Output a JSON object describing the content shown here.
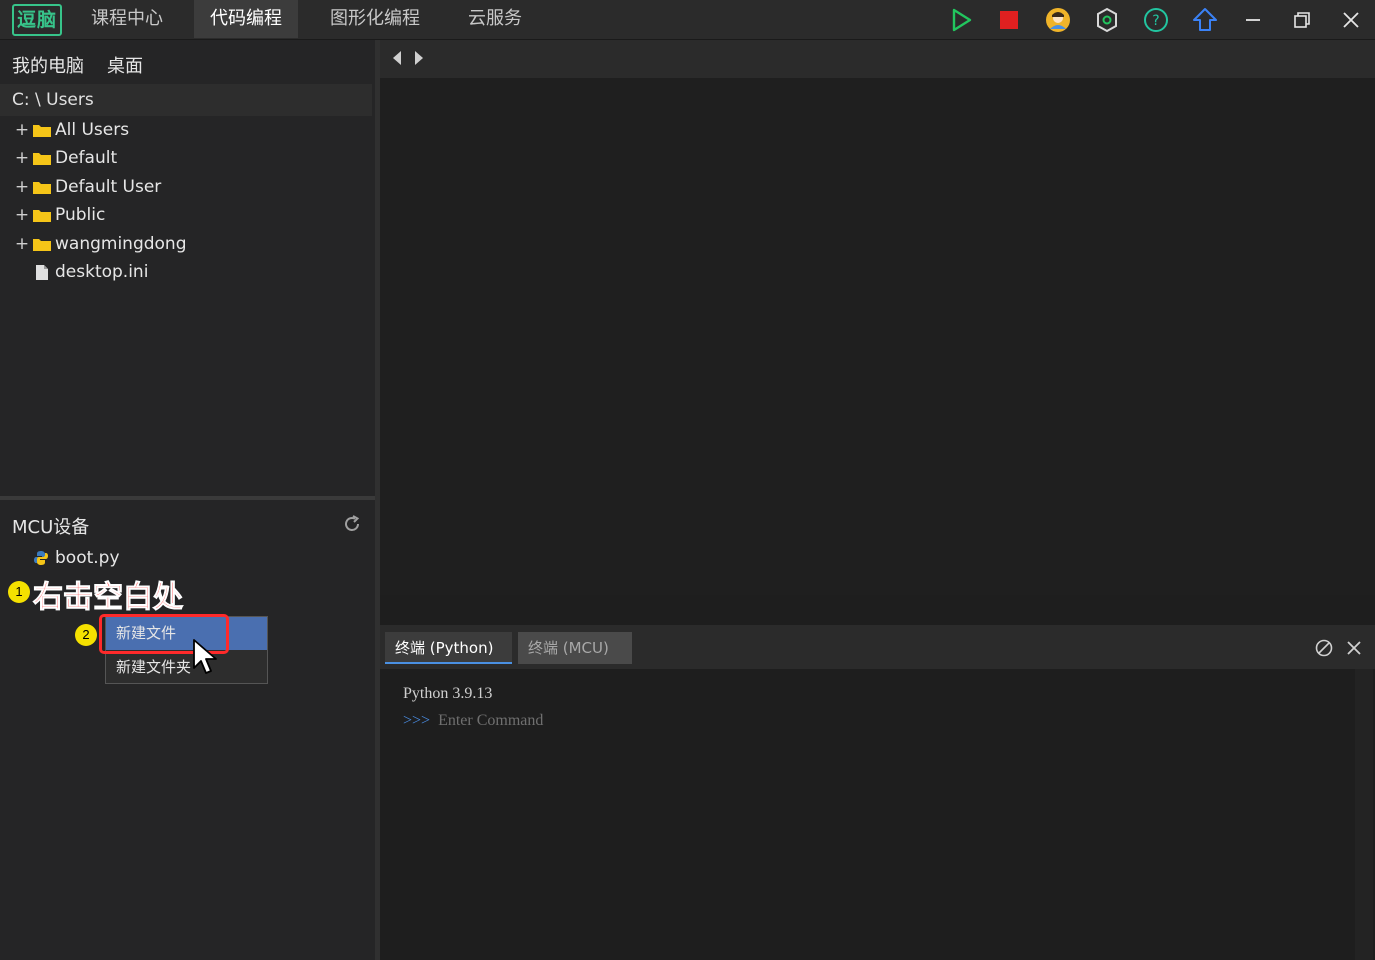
{
  "app": {
    "logo_text": "逗脑",
    "nav_tabs": [
      {
        "label": "课程中心",
        "active": false
      },
      {
        "label": "代码编程",
        "active": true
      },
      {
        "label": "图形化编程",
        "active": false
      },
      {
        "label": "云服务",
        "active": false
      }
    ],
    "toolbar_icons": [
      "run-icon",
      "stop-icon",
      "user-avatar-icon",
      "settings-hex-icon",
      "help-icon",
      "upload-icon",
      "minimize-icon",
      "restore-icon",
      "close-icon"
    ],
    "colors": {
      "accent_green": "#37c48a",
      "run_green": "#22c55e",
      "stop_red": "#e02020",
      "help_green": "#22c5a0",
      "upload_blue": "#3b82f6",
      "selection_blue": "#4a6fb0",
      "annotation_red": "#ff3030",
      "badge_yellow": "#f5e100"
    }
  },
  "file_browser": {
    "location_tabs": [
      "我的电脑",
      "桌面"
    ],
    "breadcrumb": "C: \\ Users",
    "items": [
      {
        "type": "folder",
        "label": "All Users"
      },
      {
        "type": "folder",
        "label": "Default"
      },
      {
        "type": "folder",
        "label": "Default User"
      },
      {
        "type": "folder",
        "label": "Public"
      },
      {
        "type": "folder",
        "label": "wangmingdong"
      },
      {
        "type": "file",
        "label": "desktop.ini"
      }
    ]
  },
  "mcu": {
    "title": "MCU设备",
    "files": [
      {
        "label": "boot.py",
        "icon": "python-icon"
      }
    ]
  },
  "annotation": {
    "step1_badge": "1",
    "step1_text": "右击空白处",
    "step2_badge": "2"
  },
  "context_menu": {
    "items": [
      {
        "label": "新建文件",
        "highlighted": true
      },
      {
        "label": "新建文件夹",
        "highlighted": false
      }
    ]
  },
  "terminal": {
    "tabs": [
      {
        "label": "终端 (Python)",
        "active": true
      },
      {
        "label": "终端 (MCU)",
        "active": false
      }
    ],
    "version_line": "Python 3.9.13",
    "prompt": ">>>",
    "placeholder": "Enter Command"
  }
}
